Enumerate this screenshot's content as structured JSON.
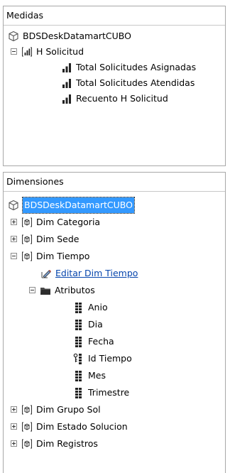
{
  "measures": {
    "title": "Medidas",
    "cube": "BDSDeskDatamartCUBO",
    "group": "H Solicitud",
    "items": [
      "Total Solicitudes Asignadas",
      "Total Solicitudes Atendidas",
      "Recuento H Solicitud"
    ]
  },
  "dimensions": {
    "title": "Dimensiones",
    "cube": "BDSDeskDatamartCUBO",
    "dim_categoria": "Dim Categoria",
    "dim_sede": "Dim Sede",
    "dim_tiempo": "Dim Tiempo",
    "edit_link": "Editar Dim Tiempo",
    "attributes": "Atributos",
    "attr_items": [
      "Anio",
      "Dia",
      "Fecha",
      "Id Tiempo",
      "Mes",
      "Trimestre"
    ],
    "dim_grupo_sol": "Dim Grupo Sol",
    "dim_estado_solucion": "Dim Estado Solucion",
    "dim_registros": "Dim Registros"
  },
  "icons": {
    "cube": "cube-icon",
    "measure_group": "measure-group-icon",
    "measure": "measure-bars-icon",
    "dimension": "dimension-icon",
    "edit": "edit-pencil-icon",
    "folder": "folder-icon",
    "attribute": "attribute-icon",
    "key_attribute": "key-attribute-icon"
  }
}
